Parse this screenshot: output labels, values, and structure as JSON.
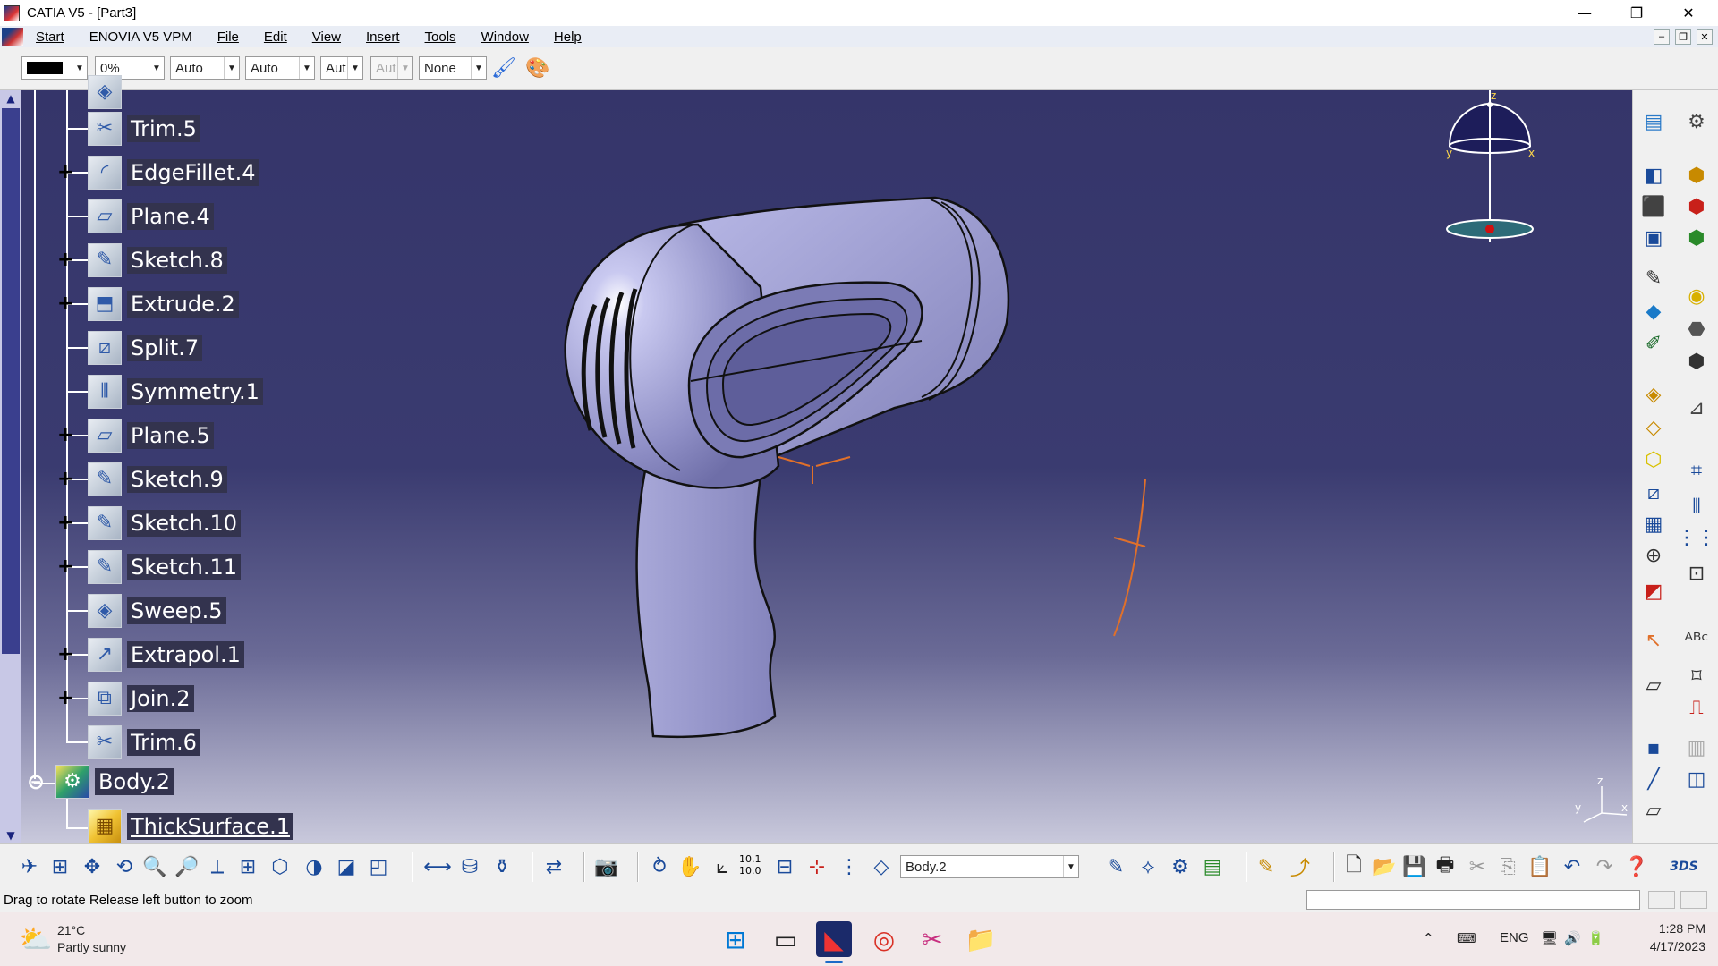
{
  "window": {
    "title": "CATIA V5 - [Part3]",
    "controls": {
      "minimize": "—",
      "maximize": "❐",
      "close": "✕"
    }
  },
  "menu": {
    "items": [
      "Start",
      "ENOVIA V5 VPM",
      "File",
      "Edit",
      "View",
      "Insert",
      "Tools",
      "Window",
      "Help"
    ],
    "mdi_controls": {
      "minimize": "–",
      "restore": "❐",
      "close": "✕"
    }
  },
  "graphic_properties": {
    "fill_color": "#000000",
    "transparency": "0%",
    "line_thickness": "Auto",
    "linetype": "Auto",
    "point_type": "Aut",
    "point_type_disabled": "Aut",
    "layer": "None"
  },
  "tree": {
    "items": [
      {
        "label": "Trim.5",
        "icon": "trim-icon",
        "expandable": false
      },
      {
        "label": "EdgeFillet.4",
        "icon": "edge-fillet-icon",
        "expandable": true
      },
      {
        "label": "Plane.4",
        "icon": "plane-icon",
        "expandable": false
      },
      {
        "label": "Sketch.8",
        "icon": "sketch-icon",
        "expandable": true
      },
      {
        "label": "Extrude.2",
        "icon": "extrude-icon",
        "expandable": true
      },
      {
        "label": "Split.7",
        "icon": "split-icon",
        "expandable": false
      },
      {
        "label": "Symmetry.1",
        "icon": "symmetry-icon",
        "expandable": false
      },
      {
        "label": "Plane.5",
        "icon": "plane-icon",
        "expandable": true
      },
      {
        "label": "Sketch.9",
        "icon": "sketch-icon",
        "expandable": true
      },
      {
        "label": "Sketch.10",
        "icon": "sketch-icon",
        "expandable": true
      },
      {
        "label": "Sketch.11",
        "icon": "sketch-icon",
        "expandable": true
      },
      {
        "label": "Sweep.5",
        "icon": "sweep-icon",
        "expandable": false
      },
      {
        "label": "Extrapol.1",
        "icon": "extrapolate-icon",
        "expandable": true
      },
      {
        "label": "Join.2",
        "icon": "join-icon",
        "expandable": true
      },
      {
        "label": "Trim.6",
        "icon": "trim-icon",
        "expandable": false
      }
    ],
    "body": {
      "label": "Body.2",
      "icon": "body-icon"
    },
    "body_child": {
      "label": "ThickSurface.1",
      "icon": "thick-surface-icon"
    }
  },
  "compass": {
    "x": "x",
    "y": "y",
    "z": "z"
  },
  "axis_triad": {
    "x": "x",
    "y": "y",
    "z": "z"
  },
  "bottom_toolbar": {
    "current_body": "Body.2",
    "scale_label_top": "10.1",
    "scale_label_bottom": "10.0"
  },
  "status": {
    "message": "Drag to rotate  Release left button to zoom"
  },
  "taskbar": {
    "weather_temp": "21°C",
    "weather_text": "Partly sunny",
    "language": "ENG",
    "time": "1:28 PM",
    "date": "4/17/2023"
  },
  "colors": {
    "viewport_top": "#35356a",
    "viewport_bottom": "#c9c9dc",
    "tree_label_bg": "#33334e"
  }
}
